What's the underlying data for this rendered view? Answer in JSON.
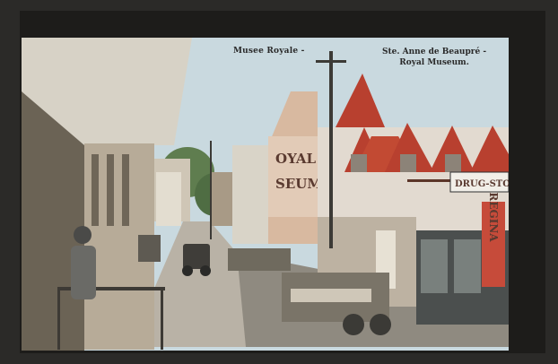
{
  "captions": {
    "left": "Musee Royale -",
    "right_line1": "Ste. Anne de Beaupré -",
    "right_line2": "Royal Museum."
  },
  "signs": {
    "building_line1": "OYAL",
    "building_line2": "SEUM",
    "drugstore": "DRUG-STO",
    "vertical": "REGINA"
  },
  "colors": {
    "sky": "#c9d9df",
    "roof_red": "#b8402f",
    "street": "#b9b2a6",
    "awning": "#d7d2c6"
  }
}
